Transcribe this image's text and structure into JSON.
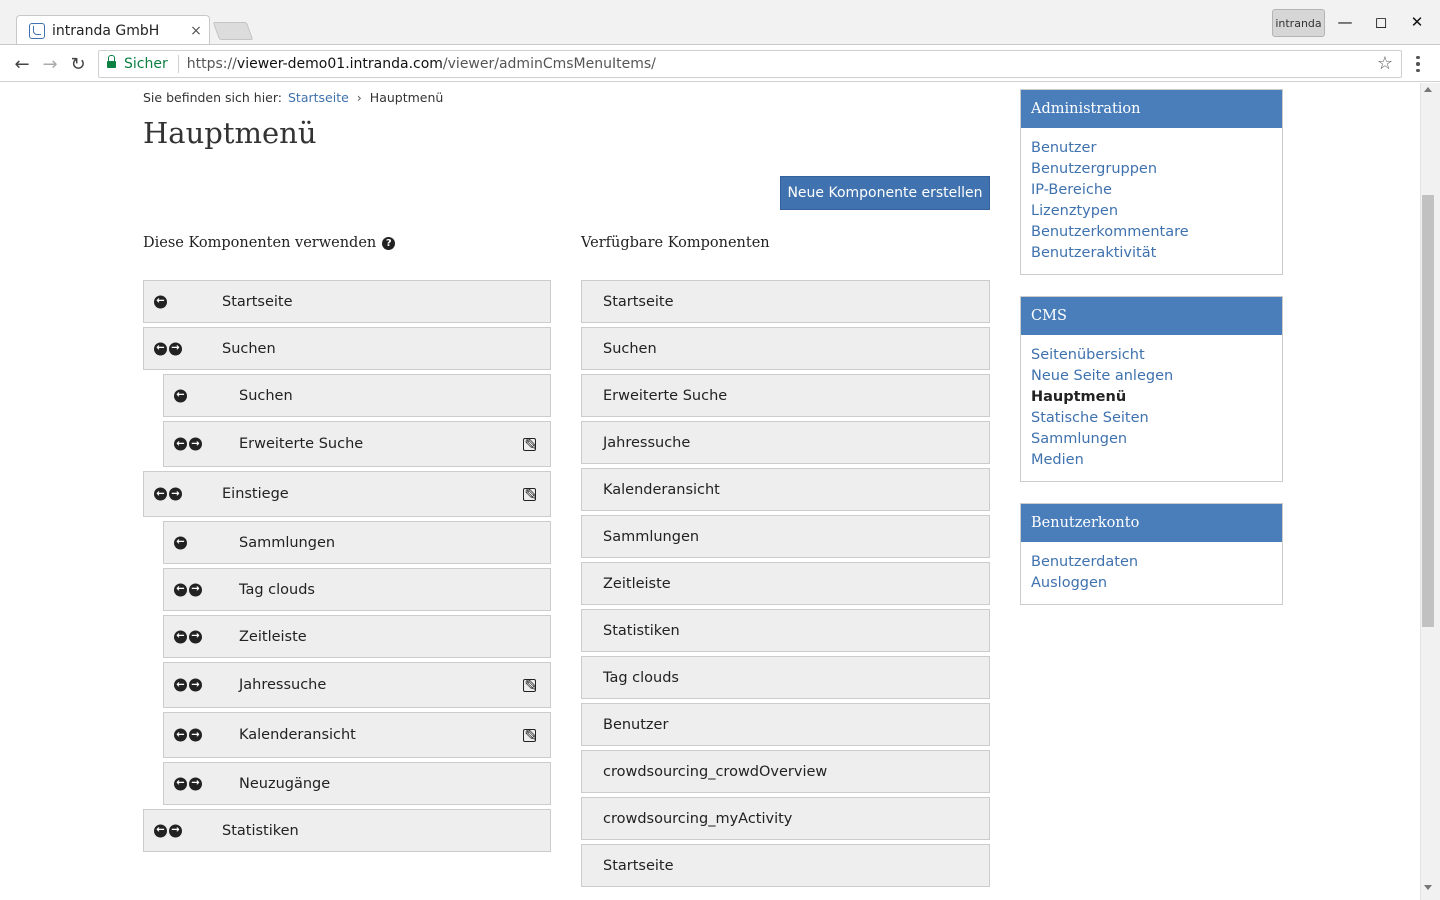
{
  "browser": {
    "tab_title": "intranda GmbH",
    "tab_close": "×",
    "profile_label": "intranda",
    "secure_label": "Sicher",
    "url_scheme": "https://",
    "url_host": "viewer-demo01.intranda.com",
    "url_path": "/viewer/adminCmsMenuItems/"
  },
  "breadcrumb": {
    "prefix": "Sie befinden sich hier:",
    "home": "Startseite",
    "separator": "›",
    "current": "Hauptmenü"
  },
  "page_title": "Hauptmenü",
  "new_component_button": "Neue Komponente erstellen",
  "used_heading": "Diese Komponenten verwenden",
  "available_heading": "Verfügbare Komponenten",
  "used_items": [
    {
      "label": "Startseite"
    },
    {
      "label": "Suchen"
    },
    {
      "label": "Suchen"
    },
    {
      "label": "Erweiterte Suche"
    },
    {
      "label": "Einstiege"
    },
    {
      "label": "Sammlungen"
    },
    {
      "label": "Tag clouds"
    },
    {
      "label": "Zeitleiste"
    },
    {
      "label": "Jahressuche"
    },
    {
      "label": "Kalenderansicht"
    },
    {
      "label": "Neuzugänge"
    },
    {
      "label": "Statistiken"
    }
  ],
  "available_items": [
    "Startseite",
    "Suchen",
    "Erweiterte Suche",
    "Jahressuche",
    "Kalenderansicht",
    "Sammlungen",
    "Zeitleiste",
    "Statistiken",
    "Tag clouds",
    "Benutzer",
    "crowdsourcing_crowdOverview",
    "crowdsourcing_myActivity",
    "Startseite"
  ],
  "sidebar": {
    "administration": {
      "title": "Administration",
      "links": [
        "Benutzer",
        "Benutzergruppen",
        "IP-Bereiche",
        "Lizenztypen",
        "Benutzerkommentare",
        "Benutzeraktivität"
      ]
    },
    "cms": {
      "title": "CMS",
      "links": [
        "Seitenübersicht",
        "Neue Seite anlegen",
        "Hauptmenü",
        "Statische Seiten",
        "Sammlungen",
        "Medien"
      ],
      "active": "Hauptmenü"
    },
    "account": {
      "title": "Benutzerkonto",
      "links": [
        "Benutzerdaten",
        "Ausloggen"
      ]
    }
  },
  "colors": {
    "accent": "#4a7ebb",
    "link": "#3f72ae",
    "item_bg": "#eeeeee",
    "secure": "#0b8043"
  }
}
